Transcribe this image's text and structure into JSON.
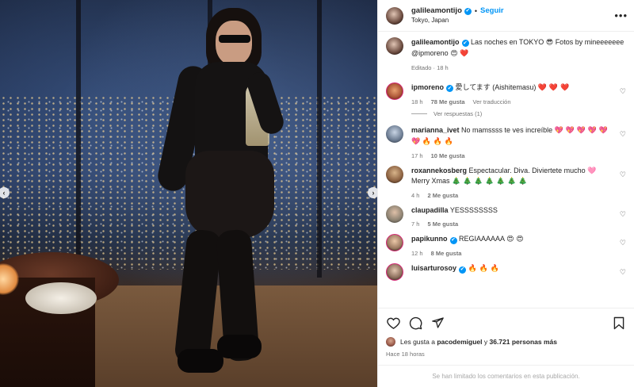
{
  "post": {
    "username": "galileamontijo",
    "follow_label": "Seguir",
    "location": "Tokyo, Japan",
    "separator": "•"
  },
  "caption": {
    "username": "galileamontijo",
    "text": "Las noches en TOKYO",
    "emoji_1": "😎",
    "text_2": "Fotos by mineeeeeee @ipmoreno",
    "emoji_2": "😍",
    "emoji_3": "❤️",
    "meta": "Editado · 18 h"
  },
  "comments": [
    {
      "username": "ipmoreno",
      "verified": true,
      "text": "愛してます (Aishitemasu)",
      "emoji": "❤️ ❤️ ❤️",
      "time": "18 h",
      "likes": "78 Me gusta",
      "extra": "Ver traducción",
      "replies": "Ver respuestas (1)"
    },
    {
      "username": "marianna_ivet",
      "verified": false,
      "text": "No mamssss te ves increíble",
      "emoji": "💖 💖 💖 💖 💖 💖",
      "emoji_2": "🔥 🔥 🔥",
      "time": "17 h",
      "likes": "10 Me gusta"
    },
    {
      "username": "roxannekosberg",
      "verified": false,
      "text": "Espectacular. Diva. Diviertete mucho 🩷 Merry Xmas",
      "emoji": "🎄 🎄 🎄 🎄 🎄 🎄 🎄",
      "time": "4 h",
      "likes": "2 Me gusta"
    },
    {
      "username": "claupadilla",
      "verified": false,
      "text": "YESSSSSSSS",
      "time": "7 h",
      "likes": "5 Me gusta"
    },
    {
      "username": "papikunno",
      "verified": true,
      "text": "REGIAAAAAA",
      "emoji": "😍 😍",
      "time": "12 h",
      "likes": "8 Me gusta"
    },
    {
      "username": "luisarturosoy",
      "verified": true,
      "text": "",
      "emoji": "🔥 🔥 🔥"
    }
  ],
  "likes_line": {
    "prefix": "Les gusta a",
    "user": "pacodemiguel",
    "middle": "y",
    "count": "36.721 personas más"
  },
  "timestamp": "Hace 18 horas",
  "comments_limited": "Se han limitado los comentarios en esta publicación.",
  "icons": {
    "verified": "✔",
    "more": "•••",
    "heart": "♡",
    "prev": "‹",
    "next": "›"
  },
  "colors": {
    "accent": "#0095f6",
    "heart_red": "#ed4956",
    "muted": "#737373"
  }
}
